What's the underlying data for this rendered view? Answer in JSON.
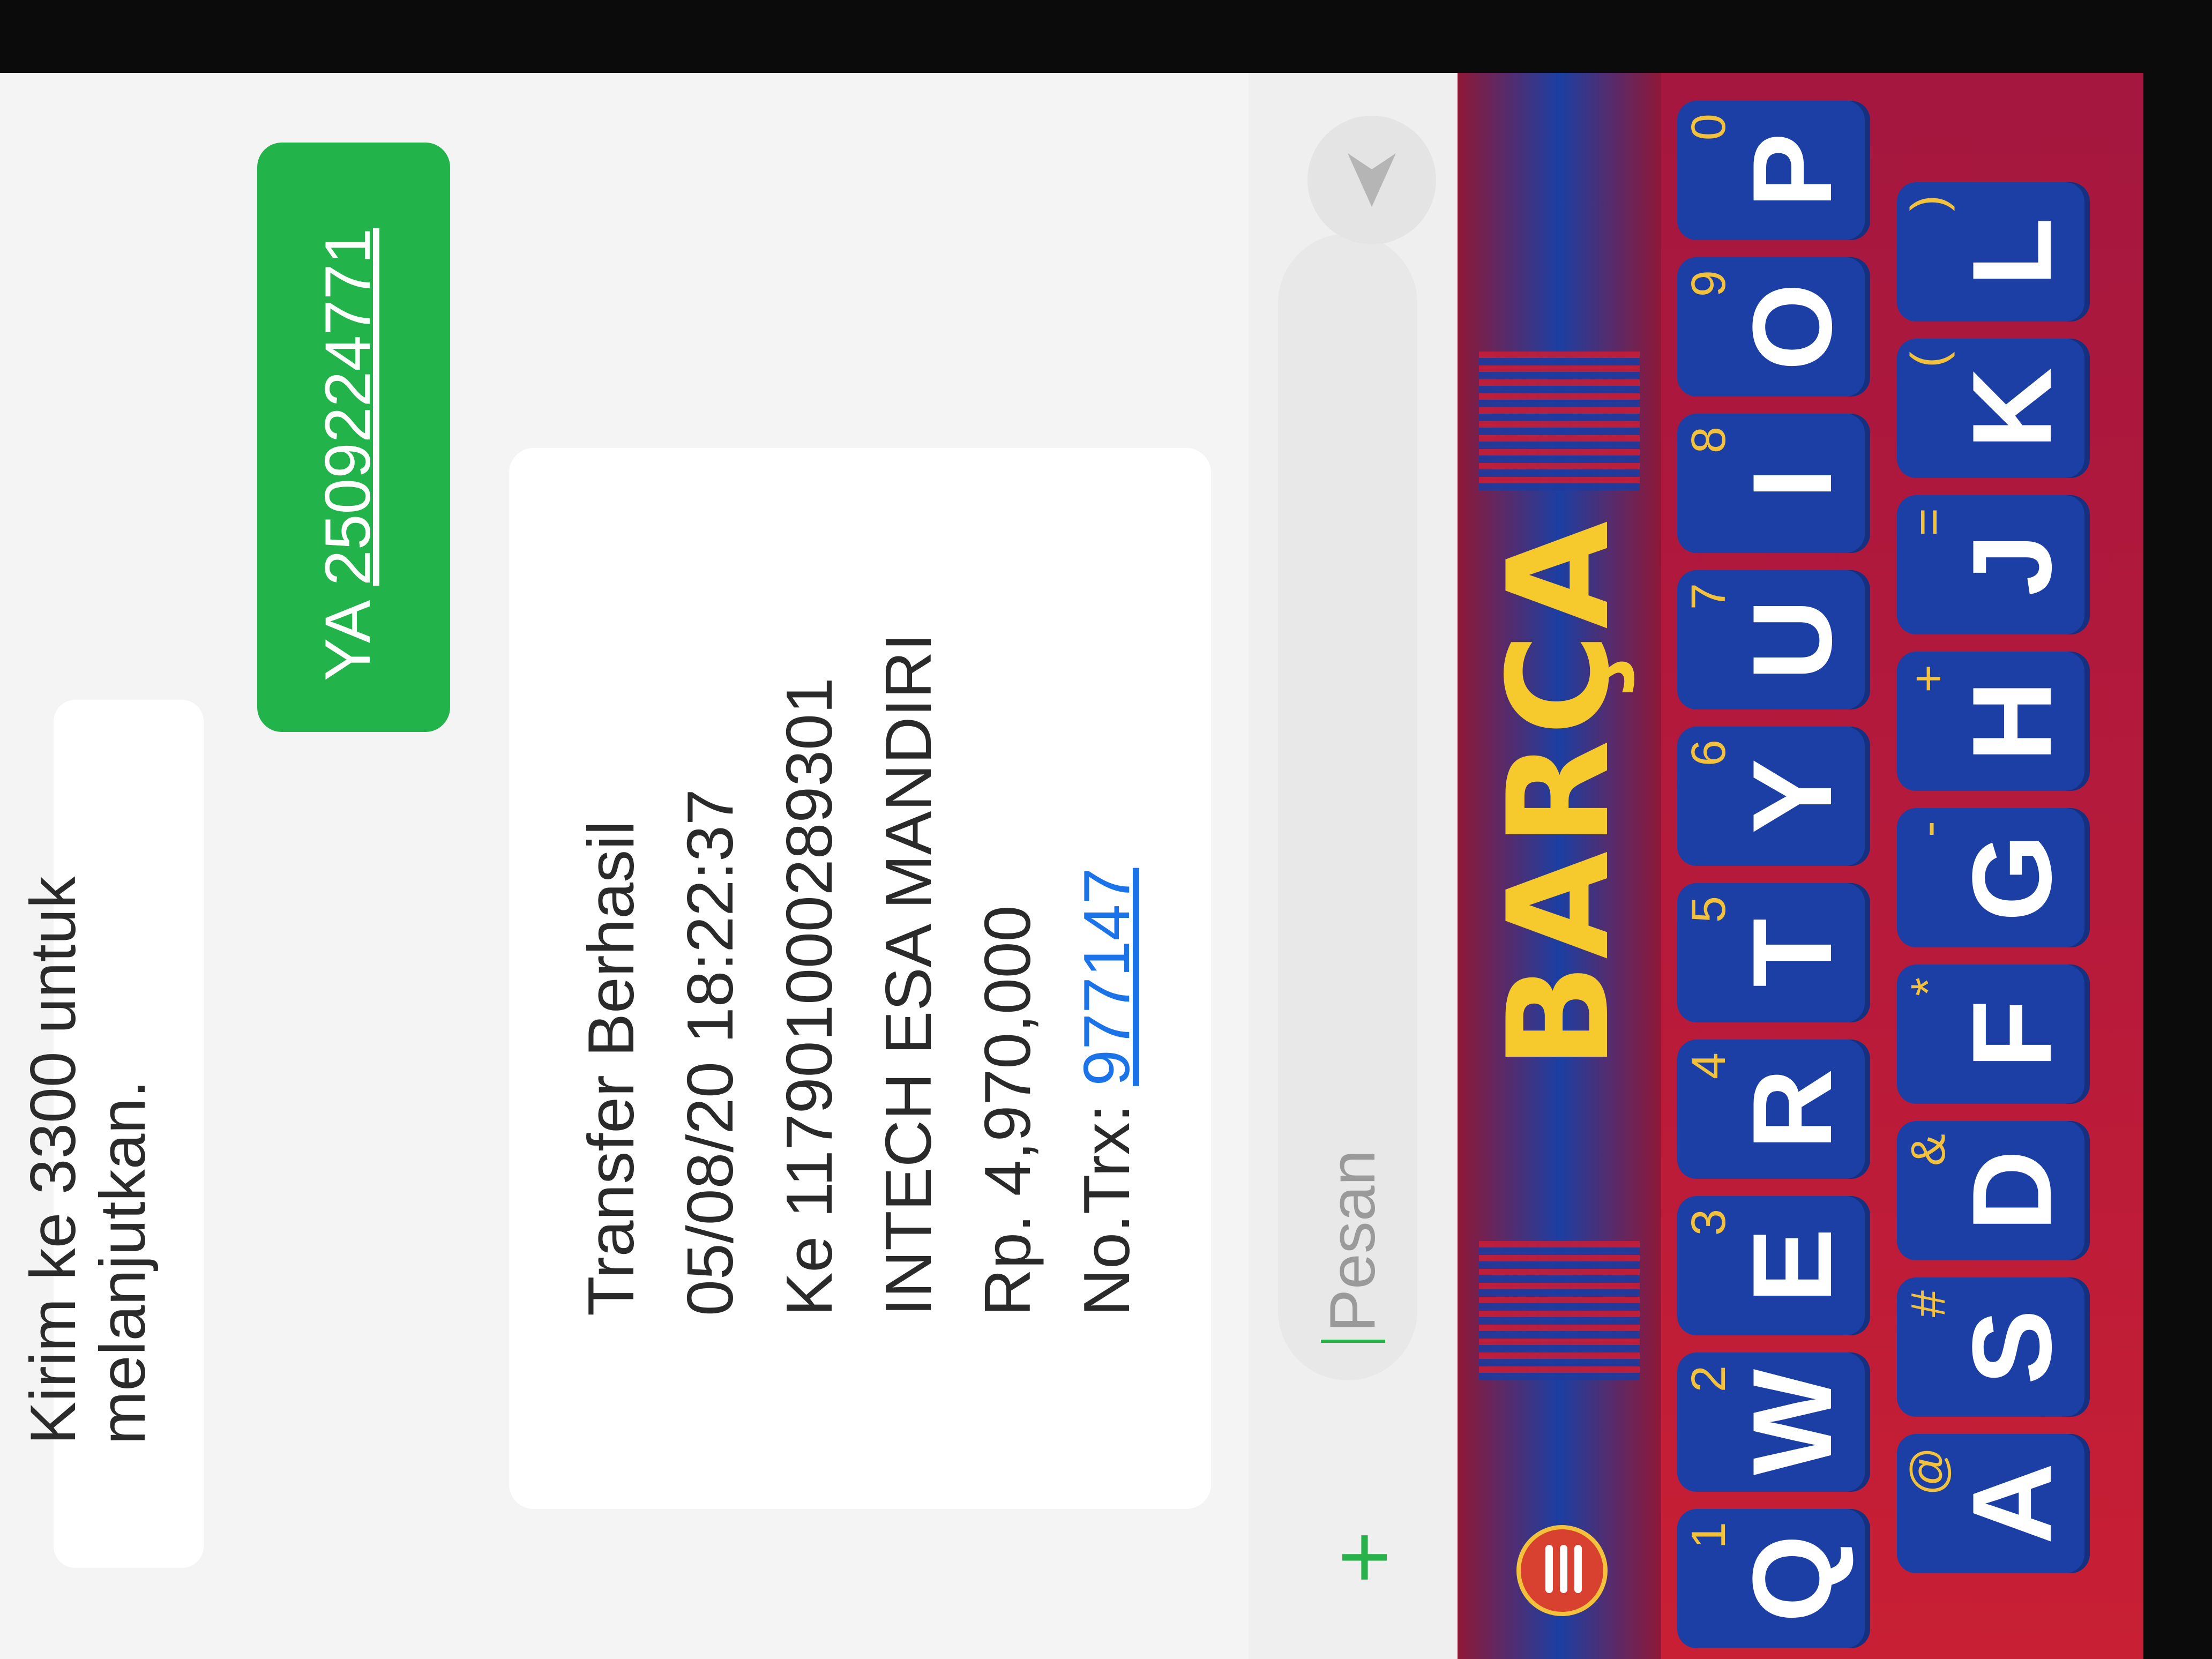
{
  "messages": {
    "top_partial_line1": "Kirim ke 3300 untuk",
    "top_partial_line2": "melanjutkan.",
    "outgoing_prefix": "YA ",
    "outgoing_code": "2509224771",
    "receipt": {
      "line1": "Transfer Berhasil",
      "line2": "05/08/20 18:22:37",
      "line3": "Ke 117901000289301",
      "line4": "INTECH ESA MANDIRI",
      "line5": "Rp. 4,970,000",
      "trx_label": "No.Trx: ",
      "trx_number": "977147"
    }
  },
  "input": {
    "plus_symbol": "+",
    "placeholder": "Pesan",
    "send_icon": "send-icon"
  },
  "keyboard": {
    "logo_text": "BARÇA",
    "menu_icon": "menu-icon",
    "row1": [
      {
        "label": "Q",
        "hint": "1"
      },
      {
        "label": "W",
        "hint": "2"
      },
      {
        "label": "E",
        "hint": "3"
      },
      {
        "label": "R",
        "hint": "4"
      },
      {
        "label": "T",
        "hint": "5"
      },
      {
        "label": "Y",
        "hint": "6"
      },
      {
        "label": "U",
        "hint": "7"
      },
      {
        "label": "I",
        "hint": "8"
      },
      {
        "label": "O",
        "hint": "9"
      },
      {
        "label": "P",
        "hint": "0"
      }
    ],
    "row2": [
      {
        "label": "A",
        "hint": "@"
      },
      {
        "label": "S",
        "hint": "#"
      },
      {
        "label": "D",
        "hint": "&"
      },
      {
        "label": "F",
        "hint": "*"
      },
      {
        "label": "G",
        "hint": "-"
      },
      {
        "label": "H",
        "hint": "+"
      },
      {
        "label": "J",
        "hint": "="
      },
      {
        "label": "K",
        "hint": "("
      },
      {
        "label": "L",
        "hint": ")"
      }
    ]
  },
  "colors": {
    "bubble_out": "#22b34a",
    "link": "#1a73e8",
    "keyboard_key": "#1c3fa6",
    "keyboard_bg": "#c81f34",
    "logo": "#f6c92c"
  }
}
